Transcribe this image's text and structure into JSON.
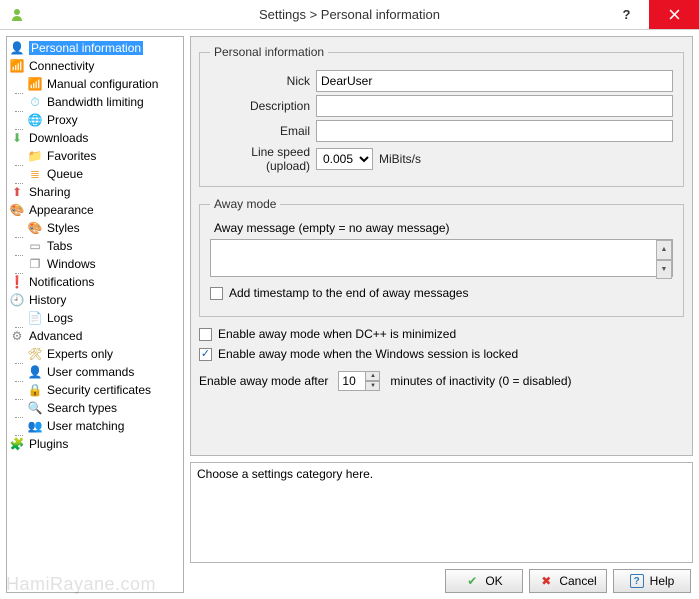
{
  "window": {
    "title": "Settings > Personal information"
  },
  "sidebar": {
    "items": [
      {
        "label": "Personal information",
        "icon": "user-icon",
        "level": 0,
        "selected": true
      },
      {
        "label": "Connectivity",
        "icon": "signal-icon",
        "level": 0
      },
      {
        "label": "Manual configuration",
        "icon": "signal-icon",
        "level": 1
      },
      {
        "label": "Bandwidth limiting",
        "icon": "gauge-icon",
        "level": 1
      },
      {
        "label": "Proxy",
        "icon": "globe-icon",
        "level": 1
      },
      {
        "label": "Downloads",
        "icon": "download-icon",
        "level": 0
      },
      {
        "label": "Favorites",
        "icon": "star-folder-icon",
        "level": 1
      },
      {
        "label": "Queue",
        "icon": "queue-icon",
        "level": 1
      },
      {
        "label": "Sharing",
        "icon": "upload-icon",
        "level": 0
      },
      {
        "label": "Appearance",
        "icon": "appearance-icon",
        "level": 0
      },
      {
        "label": "Styles",
        "icon": "palette-icon",
        "level": 1
      },
      {
        "label": "Tabs",
        "icon": "tabs-icon",
        "level": 1
      },
      {
        "label": "Windows",
        "icon": "windows-icon",
        "level": 1
      },
      {
        "label": "Notifications",
        "icon": "bell-icon",
        "level": 0
      },
      {
        "label": "History",
        "icon": "history-icon",
        "level": 0
      },
      {
        "label": "Logs",
        "icon": "logs-icon",
        "level": 1
      },
      {
        "label": "Advanced",
        "icon": "gear-icon",
        "level": 0
      },
      {
        "label": "Experts only",
        "icon": "tools-icon",
        "level": 1
      },
      {
        "label": "User commands",
        "icon": "user-cmd-icon",
        "level": 1
      },
      {
        "label": "Security certificates",
        "icon": "lock-icon",
        "level": 1
      },
      {
        "label": "Search types",
        "icon": "search-icon",
        "level": 1
      },
      {
        "label": "User matching",
        "icon": "user-match-icon",
        "level": 1
      },
      {
        "label": "Plugins",
        "icon": "plugin-icon",
        "level": 0
      }
    ]
  },
  "personal": {
    "legend": "Personal information",
    "nick_label": "Nick",
    "nick_value": "DearUser",
    "desc_label": "Description",
    "desc_value": "",
    "email_label": "Email",
    "email_value": "",
    "speed_label": "Line speed (upload)",
    "speed_value": "0.005",
    "speed_unit": "MiBits/s"
  },
  "away": {
    "legend": "Away mode",
    "msg_label": "Away message (empty = no away message)",
    "msg_value": "",
    "timestamp_label": "Add timestamp to the end of away messages",
    "timestamp_checked": false,
    "minimized_label": "Enable away mode when DC++ is minimized",
    "minimized_checked": false,
    "locked_label": "Enable away mode when the Windows session is locked",
    "locked_checked": true,
    "inactivity_prefix": "Enable away mode after",
    "inactivity_value": "10",
    "inactivity_suffix": "minutes of inactivity (0 = disabled)"
  },
  "description_panel": {
    "text": "Choose a settings category here."
  },
  "buttons": {
    "ok": "OK",
    "cancel": "Cancel",
    "help": "Help"
  },
  "watermark": "HamiRayane.com",
  "icons": {
    "user-icon": {
      "glyph": "👤",
      "color": "#5cb85c"
    },
    "signal-icon": {
      "glyph": "📶",
      "color": "#d9534f"
    },
    "gauge-icon": {
      "glyph": "⏱",
      "color": "#5bc0de"
    },
    "globe-icon": {
      "glyph": "🌐",
      "color": "#337ab7"
    },
    "download-icon": {
      "glyph": "⬇",
      "color": "#5cb85c"
    },
    "star-folder-icon": {
      "glyph": "📁",
      "color": "#f0ad4e"
    },
    "queue-icon": {
      "glyph": "≣",
      "color": "#f0ad4e"
    },
    "upload-icon": {
      "glyph": "⬆",
      "color": "#d9534f"
    },
    "appearance-icon": {
      "glyph": "🎨",
      "color": "#5bc0de"
    },
    "palette-icon": {
      "glyph": "🎨",
      "color": "#a47148"
    },
    "tabs-icon": {
      "glyph": "▭",
      "color": "#888"
    },
    "windows-icon": {
      "glyph": "❐",
      "color": "#888"
    },
    "bell-icon": {
      "glyph": "❗",
      "color": "#333"
    },
    "history-icon": {
      "glyph": "🕘",
      "color": "#555"
    },
    "logs-icon": {
      "glyph": "📄",
      "color": "#999"
    },
    "gear-icon": {
      "glyph": "⚙",
      "color": "#888"
    },
    "tools-icon": {
      "glyph": "🛠",
      "color": "#c59b28"
    },
    "user-cmd-icon": {
      "glyph": "👤",
      "color": "#d9534f"
    },
    "lock-icon": {
      "glyph": "🔒",
      "color": "#f0ad4e"
    },
    "search-icon": {
      "glyph": "🔍",
      "color": "#f0ad4e"
    },
    "user-match-icon": {
      "glyph": "👥",
      "color": "#5bc0de"
    },
    "plugin-icon": {
      "glyph": "🧩",
      "color": "#3a8ad8"
    },
    "check-icon": {
      "glyph": "✔",
      "color": "#4caf50"
    },
    "cross-icon": {
      "glyph": "✖",
      "color": "#d9322d"
    },
    "help-icon": {
      "glyph": "?",
      "color": "#337ab7"
    }
  }
}
